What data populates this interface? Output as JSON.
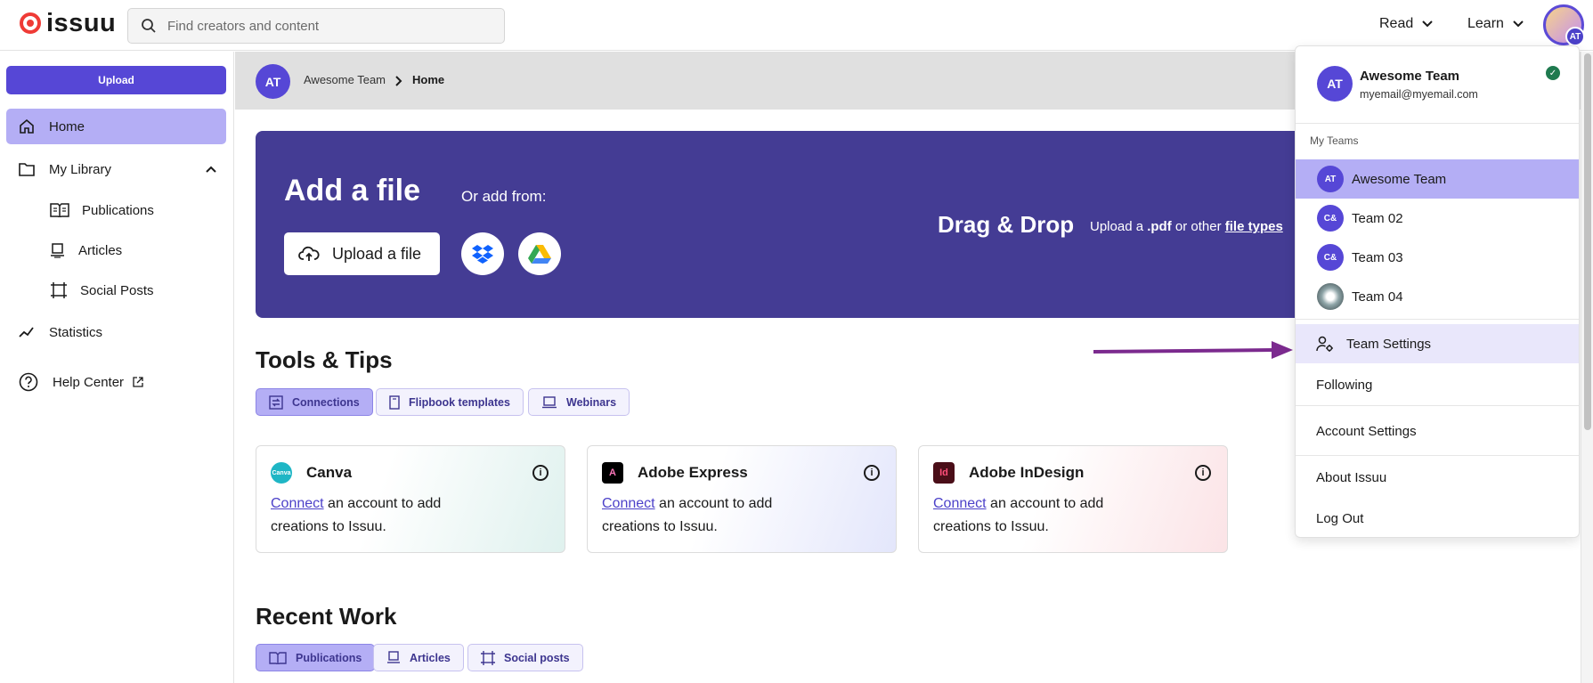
{
  "brand": {
    "name": "issuu",
    "color": "#ef3b36"
  },
  "search": {
    "placeholder": "Find creators and content"
  },
  "top_menu": {
    "read": "Read",
    "learn": "Learn",
    "avatar_initials": "AT"
  },
  "sidebar": {
    "upload": "Upload",
    "items": [
      {
        "label": "Home",
        "icon": "home-icon"
      },
      {
        "label": "My Library",
        "icon": "folder-icon"
      },
      {
        "label": "Statistics",
        "icon": "trend-icon"
      },
      {
        "label": "Help Center",
        "icon": "help-icon"
      }
    ],
    "library": [
      {
        "label": "Publications",
        "icon": "book-icon"
      },
      {
        "label": "Articles",
        "icon": "article-icon"
      },
      {
        "label": "Social Posts",
        "icon": "social-icon"
      }
    ]
  },
  "breadcrumb": {
    "initials": "AT",
    "team": "Awesome Team",
    "current": "Home"
  },
  "hero": {
    "title": "Add a file",
    "or_add_from": "Or add from:",
    "upload_label": "Upload a file",
    "drag_drop": "Drag & Drop",
    "drag_sub_prefix": "Upload a",
    "drag_sub_ext": ".pdf",
    "drag_sub_mid": "or other",
    "drag_sub_link": "file types",
    "background": "#443c94"
  },
  "tools": {
    "title": "Tools & Tips",
    "chips": [
      "Connections",
      "Flipbook templates",
      "Webinars"
    ]
  },
  "cards": [
    {
      "title": "Canva",
      "logo": "Canva",
      "link": "Connect",
      "text": "an account to add creations to Issuu."
    },
    {
      "title": "Adobe Express",
      "logo": "A",
      "link": "Connect",
      "text": "an account to add creations to Issuu."
    },
    {
      "title": "Adobe InDesign",
      "logo": "Id",
      "link": "Connect",
      "text": "an account to add creations to Issuu."
    }
  ],
  "recent": {
    "title": "Recent Work",
    "chips": [
      "Publications",
      "Articles",
      "Social posts"
    ]
  },
  "dropdown": {
    "user": {
      "initials": "AT",
      "name": "Awesome Team",
      "email": "myemail@myemail.com"
    },
    "my_teams_label": "My Teams",
    "teams": [
      {
        "initials": "AT",
        "name": "Awesome Team"
      },
      {
        "initials": "C&",
        "name": "Team 02"
      },
      {
        "initials": "C&",
        "name": "Team 03"
      },
      {
        "initials": "",
        "name": "Team 04"
      }
    ],
    "team_settings": "Team Settings",
    "following": "Following",
    "account_settings": "Account Settings",
    "about": "About Issuu",
    "logout": "Log Out"
  },
  "colors": {
    "accent": "#5647d6",
    "selected": "#b4aef5",
    "arrow": "#7b2a8e"
  }
}
